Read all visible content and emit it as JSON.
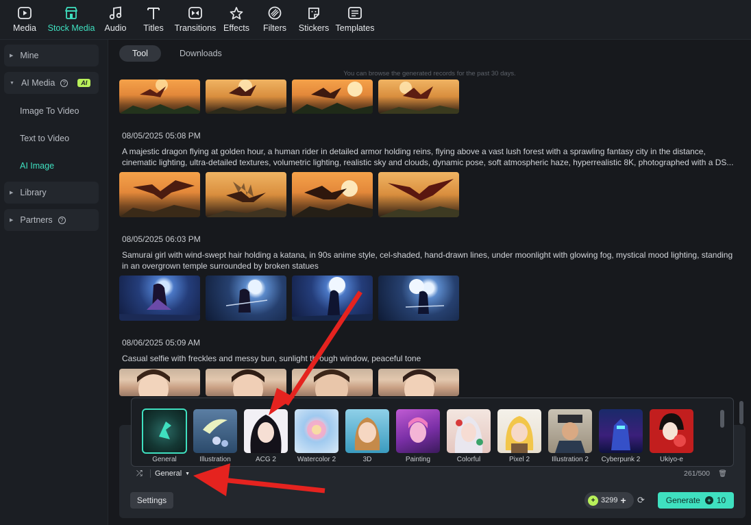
{
  "toolbar": {
    "items": [
      {
        "label": "Media",
        "icon": "media-icon",
        "active": false
      },
      {
        "label": "Stock Media",
        "icon": "stock-media-icon",
        "active": true
      },
      {
        "label": "Audio",
        "icon": "music-note-icon",
        "active": false
      },
      {
        "label": "Titles",
        "icon": "text-icon",
        "active": false
      },
      {
        "label": "Transitions",
        "icon": "transitions-icon",
        "active": false
      },
      {
        "label": "Effects",
        "icon": "effects-icon",
        "active": false
      },
      {
        "label": "Filters",
        "icon": "filters-icon",
        "active": false
      },
      {
        "label": "Stickers",
        "icon": "stickers-icon",
        "active": false
      },
      {
        "label": "Templates",
        "icon": "templates-icon",
        "active": false
      }
    ]
  },
  "sidebar": {
    "mine": "Mine",
    "ai_media": "AI Media",
    "ai_badge": "AI",
    "image_to_video": "Image To Video",
    "text_to_video": "Text to Video",
    "ai_image": "AI Image",
    "library": "Library",
    "partners": "Partners"
  },
  "tabs": {
    "tool": "Tool",
    "downloads": "Downloads"
  },
  "notice": "You can browse the generated records for the past 30 days.",
  "records": [
    {
      "timestamp": "08/05/2025 05:08 PM",
      "prompt": "A majestic dragon flying at golden hour, a human rider in detailed armor holding reins, flying above a vast lush forest with a sprawling fantasy city in the distance, cinematic lighting, ultra-detailed textures, volumetric lighting, realistic sky and clouds, dynamic pose, soft atmospheric haze, hyperrealistic 8K, photographed with a DS..."
    },
    {
      "timestamp": "08/05/2025 06:03 PM",
      "prompt": "Samurai girl with wind-swept hair holding a katana, in 90s anime style, cel-shaded, hand-drawn lines, under moonlight with glowing fog, mystical mood lighting, standing in an overgrown temple surrounded by broken statues"
    },
    {
      "timestamp": "08/06/2025 05:09 AM",
      "prompt": "Casual selfie with freckles and messy bun, sunlight through window, peaceful tone"
    }
  ],
  "styles": [
    {
      "name": "General",
      "selected": true
    },
    {
      "name": "Illustration"
    },
    {
      "name": "ACG 2"
    },
    {
      "name": "Watercolor 2"
    },
    {
      "name": "3D"
    },
    {
      "name": "Painting"
    },
    {
      "name": "Colorful"
    },
    {
      "name": "Pixel 2"
    },
    {
      "name": "Illustration 2"
    },
    {
      "name": "Cyberpunk 2"
    },
    {
      "name": "Ukiyo-e"
    }
  ],
  "composer": {
    "style_value": "General",
    "char_count": "261/500",
    "settings_label": "Settings",
    "credits": "3299",
    "generate_label": "Generate",
    "generate_cost": "10"
  },
  "colors": {
    "accent": "#3fe0c0",
    "badge": "#b8f05a",
    "annotation_arrow": "#e5231f"
  }
}
